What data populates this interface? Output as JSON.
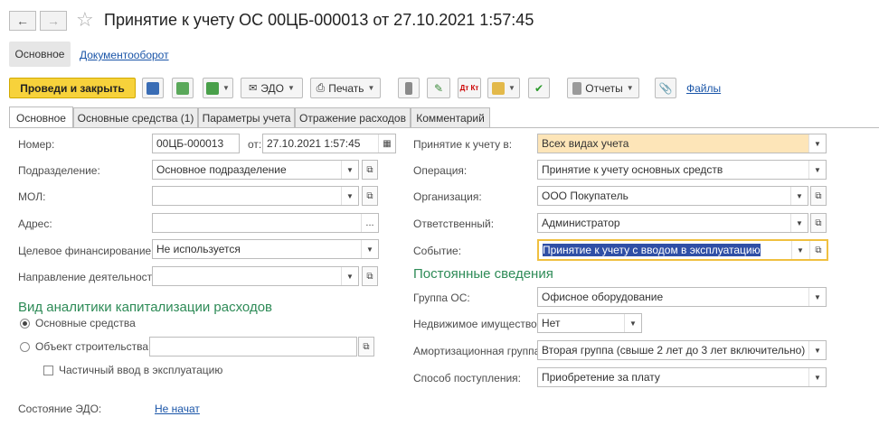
{
  "header": {
    "back_icon": "arrow-left-icon",
    "forward_icon": "arrow-right-icon",
    "favorite_icon": "star-icon",
    "title": "Принятие к учету ОС 00ЦБ-000013 от 27.10.2021 1:57:45"
  },
  "nav": {
    "main_label": "Основное",
    "docflow_label": "Документооборот"
  },
  "toolbar": {
    "post_close_label": "Проведи и закрыть",
    "edo_label": "ЭДО",
    "print_label": "Печать",
    "reports_label": "Отчеты",
    "files_label": "Файлы",
    "dtkt_label": "Дт Кт",
    "accent_color": "#f7d23b"
  },
  "tabs": [
    {
      "label": "Основное"
    },
    {
      "label": "Основные средства (1)"
    },
    {
      "label": "Параметры учета"
    },
    {
      "label": "Отражение расходов"
    },
    {
      "label": "Комментарий"
    }
  ],
  "left": {
    "number_label": "Номер:",
    "number_value": "00ЦБ-000013",
    "date_prefix": "от:",
    "date_value": "27.10.2021  1:57:45",
    "division_label": "Подразделение:",
    "division_value": "Основное подразделение",
    "mol_label": "МОЛ:",
    "mol_value": "",
    "address_label": "Адрес:",
    "address_value": "",
    "address_button": "...",
    "financing_label": "Целевое финансирование:",
    "financing_value": "Не используется",
    "activity_label": "Направление деятельности:",
    "activity_value": "",
    "capitalization_title": "Вид аналитики капитализации расходов",
    "radio_fixed_assets": "Основные средства",
    "radio_construction": "Объект строительства:",
    "construction_value": "",
    "partial_commissioning": "Частичный ввод в эксплуатацию",
    "edo_state_label": "Состояние ЭДО:",
    "edo_state_value": "Не начат"
  },
  "right": {
    "acceptance_label": "Принятие к учету в:",
    "acceptance_value": "Всех видах учета",
    "acceptance_color": "#fde5b8",
    "operation_label": "Операция:",
    "operation_value": "Принятие к учету основных средств",
    "organization_label": "Организация:",
    "organization_value": "ООО Покупатель",
    "responsible_label": "Ответственный:",
    "responsible_value": "Администратор",
    "event_label": "Событие:",
    "event_value": "Принятие к учету с вводом в эксплуатацию",
    "permanent_title": "Постоянные сведения",
    "group_label": "Группа ОС:",
    "group_value": "Офисное оборудование",
    "realestate_label": "Недвижимое имущество:",
    "realestate_value": "Нет",
    "amort_label": "Амортизационная группа:",
    "amort_value": "Вторая группа (свыше 2 лет до 3 лет включительно)",
    "receipt_label": "Способ поступления:",
    "receipt_value": "Приобретение за плату"
  }
}
